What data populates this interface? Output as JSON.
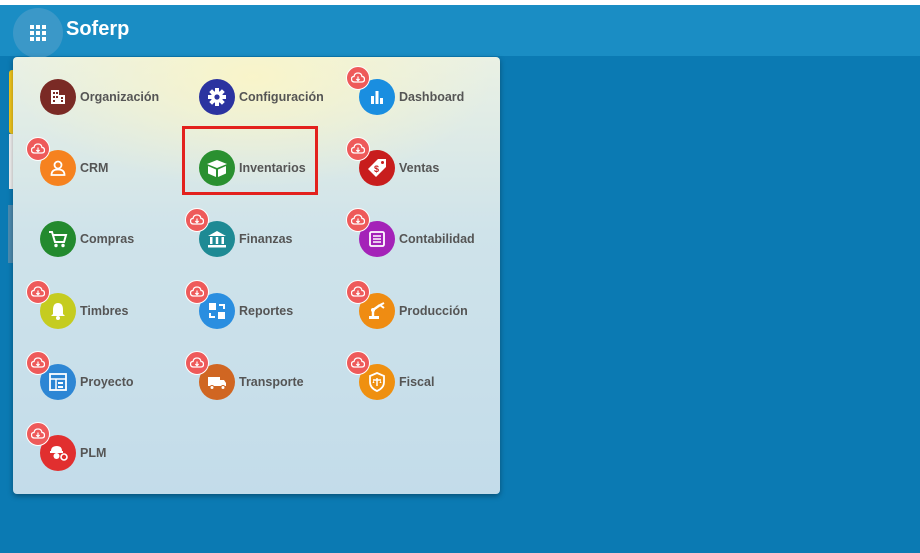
{
  "header": {
    "app_name": "Soferp",
    "apps_icon": "grid-icon"
  },
  "colors": {
    "background": "#0b7ab3",
    "header": "#1a8dc4",
    "badge": "#ee5a5a",
    "highlight_border": "#e3211d"
  },
  "apps_menu": {
    "items": [
      {
        "label": "Organización",
        "icon": "building-icon",
        "color": "#7a2a25",
        "badge": false
      },
      {
        "label": "Configuración",
        "icon": "gear-icon",
        "color": "#2b33a0",
        "badge": false
      },
      {
        "label": "Dashboard",
        "icon": "bar-chart-icon",
        "color": "#1a8ee0",
        "badge": true
      },
      {
        "label": "CRM",
        "icon": "user-icon",
        "color": "#f6821f",
        "badge": true
      },
      {
        "label": "Inventarios",
        "icon": "box-icon",
        "color": "#2a9030",
        "badge": false,
        "highlighted": true
      },
      {
        "label": "Ventas",
        "icon": "price-tag-icon",
        "color": "#c81d1d",
        "badge": true
      },
      {
        "label": "Compras",
        "icon": "shopping-cart-icon",
        "color": "#238a2e",
        "badge": false
      },
      {
        "label": "Finanzas",
        "icon": "bank-icon",
        "color": "#1e8a94",
        "badge": true
      },
      {
        "label": "Contabilidad",
        "icon": "ledger-icon",
        "color": "#a422b8",
        "badge": true
      },
      {
        "label": "Timbres",
        "icon": "bell-icon",
        "color": "#c5cc20",
        "badge": true
      },
      {
        "label": "Reportes",
        "icon": "report-icon",
        "color": "#2a8ee0",
        "badge": true
      },
      {
        "label": "Producción",
        "icon": "robot-arm-icon",
        "color": "#ef8c12",
        "badge": true
      },
      {
        "label": "Proyecto",
        "icon": "project-icon",
        "color": "#2d86d4",
        "badge": true
      },
      {
        "label": "Transporte",
        "icon": "truck-icon",
        "color": "#d06622",
        "badge": true
      },
      {
        "label": "Fiscal",
        "icon": "shield-scale-icon",
        "color": "#ef9010",
        "badge": true
      },
      {
        "label": "PLM",
        "icon": "worker-gear-icon",
        "color": "#e12f2f",
        "badge": true
      }
    ],
    "badge_icon": "cloud-download-icon"
  }
}
